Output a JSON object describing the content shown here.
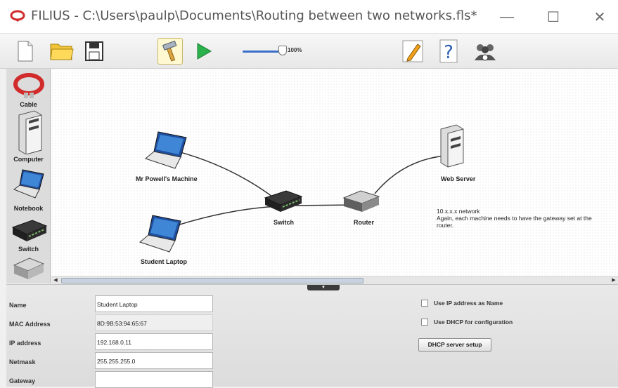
{
  "window": {
    "title": "FILIUS - C:\\Users\\paulp\\Documents\\Routing between two networks.fls*",
    "minimize": "—",
    "maximize": "☐",
    "close": "✕"
  },
  "toolbar": {
    "zoom_label": "100%"
  },
  "palette": {
    "items": [
      {
        "label": "Cable",
        "icon": "cable-icon"
      },
      {
        "label": "Computer",
        "icon": "computer-icon"
      },
      {
        "label": "Notebook",
        "icon": "notebook-icon"
      },
      {
        "label": "Switch",
        "icon": "switch-icon"
      },
      {
        "label": "",
        "icon": "router-icon"
      }
    ]
  },
  "canvas": {
    "nodes": {
      "mr_powell": "Mr Powell's Machine",
      "student_laptop": "Student Laptop",
      "switch": "Switch",
      "router": "Router",
      "web_server": "Web Server"
    },
    "note": {
      "line1": "10.x.x.x network",
      "line2": "Again, each machine needs to have the gateway set at the router."
    }
  },
  "properties": {
    "name_label": "Name",
    "name_value": "Student Laptop",
    "mac_label": "MAC Address",
    "mac_value": "8D:9B:53:94:65:67",
    "ip_label": "IP address",
    "ip_value": "192.168.0.11",
    "netmask_label": "Netmask",
    "netmask_value": "255.255.255.0",
    "gateway_label": "Gateway",
    "gateway_value": "",
    "use_ip_as_name": "Use IP address as Name",
    "use_dhcp": "Use DHCP for configuration",
    "dhcp_setup": "DHCP server setup"
  },
  "colors": {
    "accent": "#3a6fc9",
    "logo": "#d12b2b"
  }
}
